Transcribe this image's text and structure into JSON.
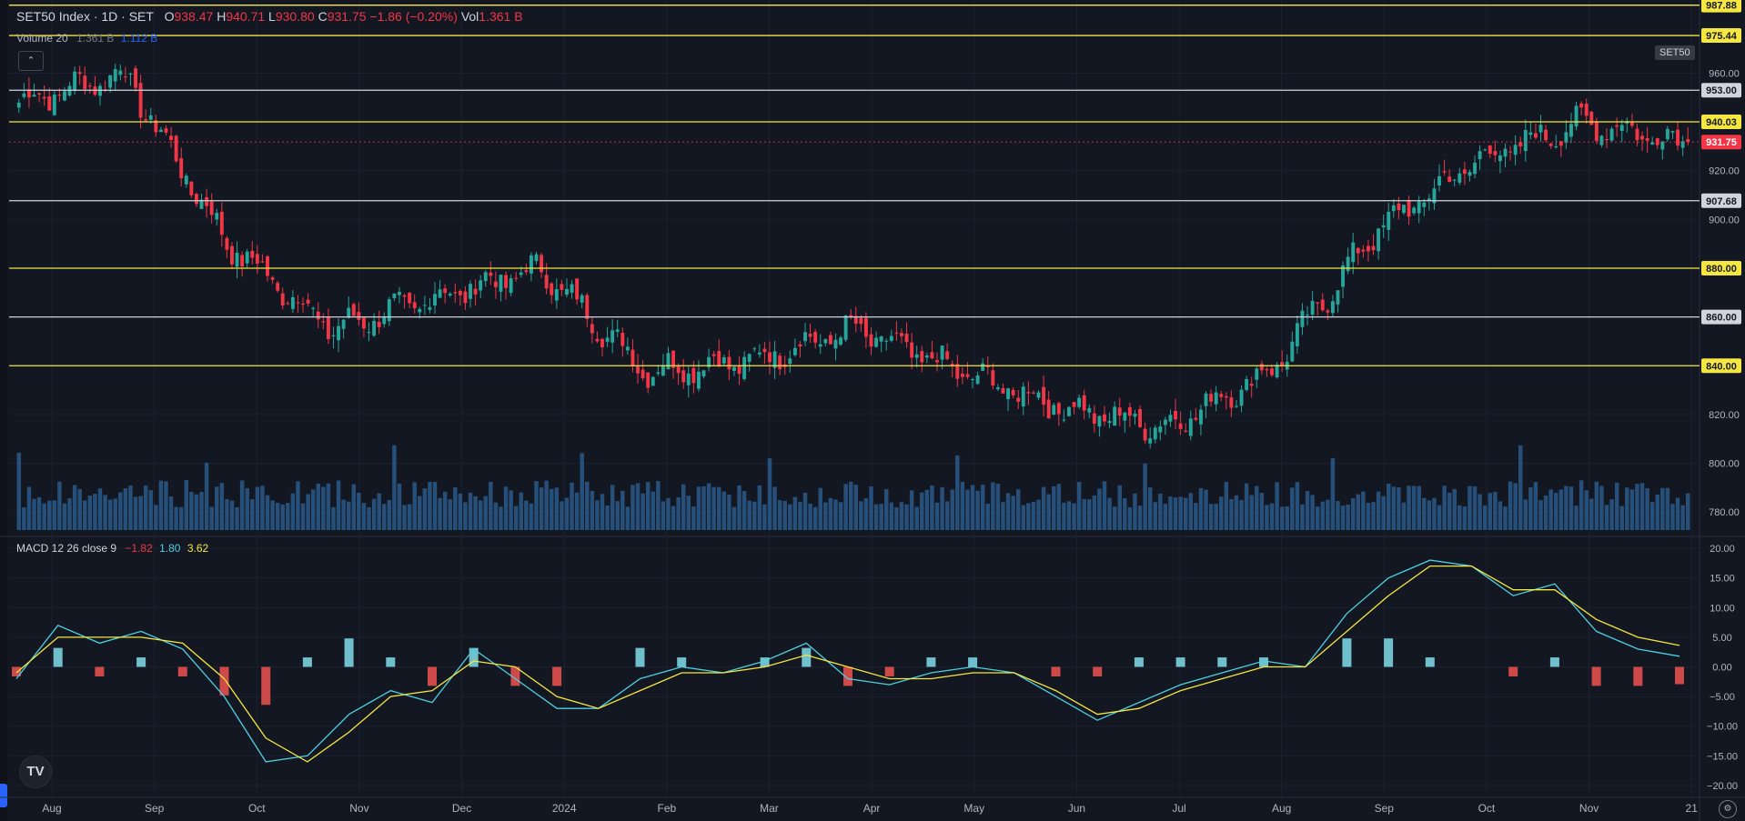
{
  "legend": {
    "title": "SET50 Index · 1D · SET",
    "o_label": "O",
    "o_value": "938.47",
    "h_label": "H",
    "h_value": "940.71",
    "l_label": "L",
    "l_value": "930.80",
    "c_label": "C",
    "c_value": "931.75 −1.86 (−0.20%)",
    "vol_label": "Vol",
    "vol_value": "1.361 B"
  },
  "volume_legend": {
    "label": "Volume 20",
    "v1": "1.361 B",
    "v2": "1.112 B"
  },
  "macd_legend": {
    "label": "MACD 12 26 close 9",
    "v1": "−1.82",
    "v2": "1.80",
    "v3": "3.62"
  },
  "symbol_badge": "SET50",
  "logo_text": "TV",
  "collapse_icon": "chevron-up-icon",
  "colors": {
    "up": "#26a69a",
    "down": "#f23645",
    "level_yellow": "#f5e642",
    "level_white": "#d1d4dc",
    "bg": "#131722"
  },
  "chart_data": [
    {
      "type": "candlestick",
      "title": "SET50 Index · 1D · SET",
      "ylim": [
        770,
        990
      ],
      "price_ticks": [
        780,
        800,
        820,
        840,
        860,
        880,
        900,
        920,
        940,
        960
      ],
      "x_labels": [
        "Aug",
        "Sep",
        "Oct",
        "Nov",
        "Dec",
        "2024",
        "Feb",
        "Mar",
        "Apr",
        "May",
        "Jun",
        "Jul",
        "Aug",
        "Sep",
        "Oct",
        "Nov",
        "21"
      ],
      "levels": [
        {
          "value": 987.88,
          "label": "987.88",
          "color": "yellow"
        },
        {
          "value": 975.44,
          "label": "975.44",
          "color": "yellow"
        },
        {
          "value": 953.0,
          "label": "953.00",
          "color": "white"
        },
        {
          "value": 940.03,
          "label": "940.03",
          "color": "yellow"
        },
        {
          "value": 907.68,
          "label": "907.68",
          "color": "white"
        },
        {
          "value": 880.0,
          "label": "880.00",
          "color": "yellow"
        },
        {
          "value": 860.0,
          "label": "860.00",
          "color": "white"
        },
        {
          "value": 840.0,
          "label": "840.00",
          "color": "yellow"
        }
      ],
      "last_price": {
        "value": 931.75,
        "label": "931.75"
      },
      "monthly_closes": [
        {
          "month": "Aug",
          "close": 948
        },
        {
          "month": "Sep",
          "close": 960
        },
        {
          "month": "Oct",
          "close": 890
        },
        {
          "month": "Nov",
          "close": 855
        },
        {
          "month": "Dec",
          "close": 868
        },
        {
          "month": "2024",
          "close": 880
        },
        {
          "month": "Feb",
          "close": 838
        },
        {
          "month": "Mar",
          "close": 842
        },
        {
          "month": "Apr",
          "close": 855
        },
        {
          "month": "May",
          "close": 838
        },
        {
          "month": "Jun",
          "close": 823
        },
        {
          "month": "Jul",
          "close": 815
        },
        {
          "month": "Aug",
          "close": 838
        },
        {
          "month": "Sep",
          "close": 895
        },
        {
          "month": "Oct",
          "close": 925
        },
        {
          "month": "Nov",
          "close": 940
        },
        {
          "month": "21",
          "close": 931.75
        }
      ]
    },
    {
      "type": "bar",
      "title": "Volume 20",
      "series": [
        {
          "name": "Volume",
          "last": "1.361 B"
        },
        {
          "name": "MA",
          "last": "1.112 B"
        }
      ]
    },
    {
      "type": "line",
      "title": "MACD 12 26 close 9",
      "ylim": [
        -22,
        22
      ],
      "ticks": [
        20.0,
        15.0,
        10.0,
        5.0,
        0.0,
        -5.0,
        -10.0,
        -15.0,
        -20.0
      ],
      "tick_labels": [
        "20.00",
        "15.00",
        "10.00",
        "5.00",
        "0.00",
        "−5.00",
        "−10.00",
        "−15.00",
        "−20.00"
      ],
      "series": [
        {
          "name": "MACD",
          "values": [
            -2,
            7,
            4,
            6,
            3,
            -5,
            -16,
            -15,
            -8,
            -4,
            -6,
            3,
            -2,
            -7,
            -7,
            -2,
            0,
            -1,
            1,
            4,
            -2,
            -3,
            -1,
            0,
            -1,
            -5,
            -9,
            -6,
            -3,
            -1,
            1,
            0,
            9,
            15,
            18,
            17,
            12,
            14,
            6,
            3,
            1.8
          ]
        },
        {
          "name": "Signal",
          "values": [
            -1,
            5,
            5,
            5,
            4,
            -2,
            -12,
            -16,
            -11,
            -5,
            -4,
            1,
            0,
            -5,
            -7,
            -4,
            -1,
            -1,
            0,
            2,
            0,
            -2,
            -2,
            -1,
            -1,
            -4,
            -8,
            -7,
            -4,
            -2,
            0,
            0,
            6,
            12,
            17,
            17,
            13,
            13,
            8,
            5,
            3.62
          ]
        }
      ]
    }
  ]
}
